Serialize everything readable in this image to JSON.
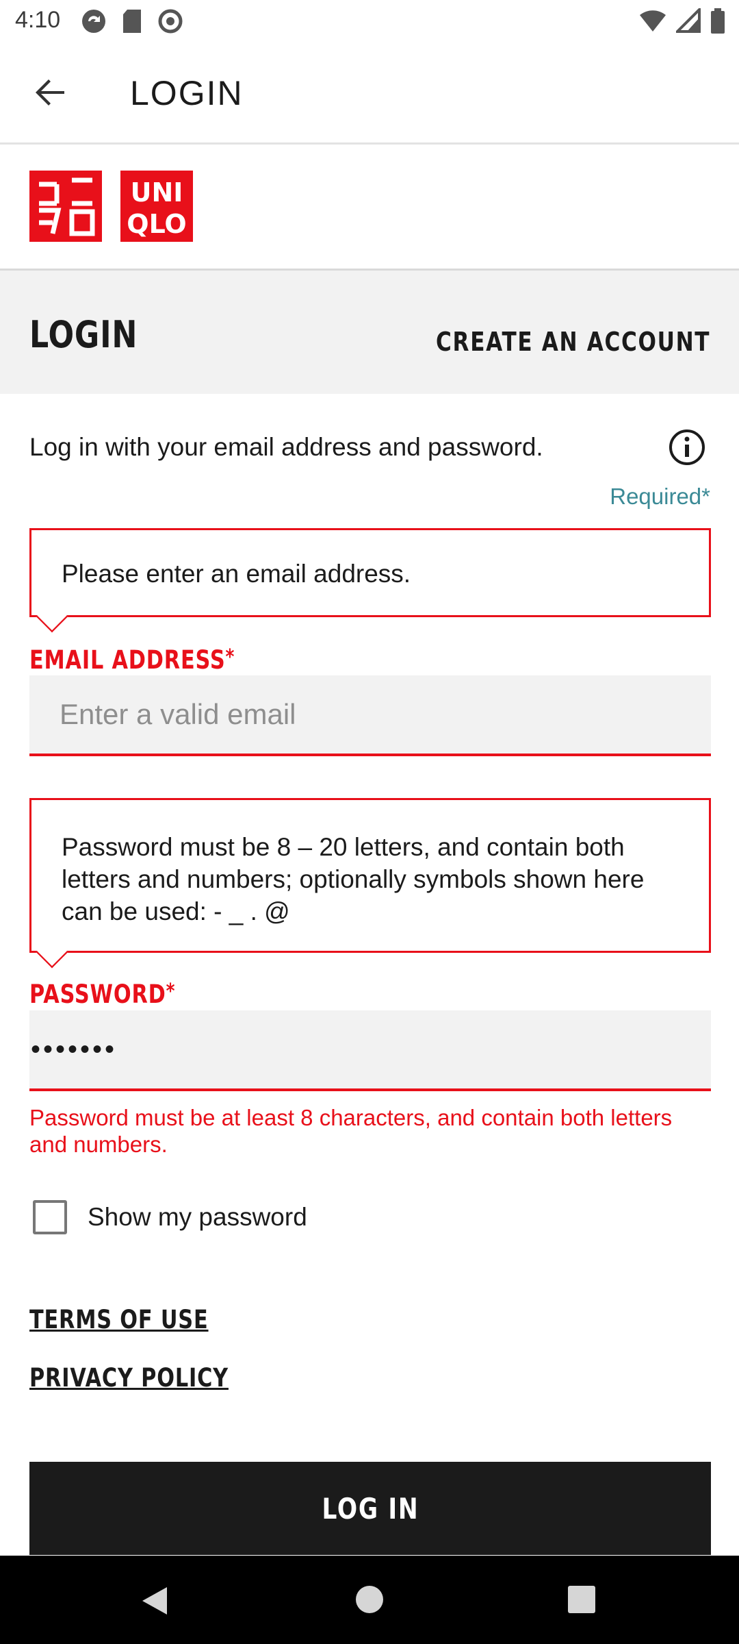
{
  "status_bar": {
    "time": "4:10"
  },
  "app_bar": {
    "title": "LOGIN"
  },
  "logo": {
    "brand": "UNIQLO",
    "text_lines": [
      "UNI",
      "QLO"
    ],
    "color": "#e8101a"
  },
  "tabs": {
    "login": "LOGIN",
    "create_account": "CREATE AN ACCOUNT"
  },
  "form": {
    "intro": "Log in with your email address and password.",
    "required_label": "Required",
    "required_mark": "*",
    "email": {
      "tooltip": "Please enter an email address.",
      "label": "EMAIL ADDRESS",
      "placeholder": "Enter a valid email",
      "value": ""
    },
    "password": {
      "tooltip": "Password must be 8 – 20 letters, and contain both letters and numbers; optionally symbols shown here can be used: - _ . @",
      "label": "PASSWORD",
      "value": "•••••••",
      "error": "Password must be at least 8 characters, and contain both letters and numbers."
    },
    "show_password": {
      "label": "Show my password",
      "checked": false
    }
  },
  "links": {
    "terms": "TERMS OF USE",
    "privacy": "PRIVACY POLICY"
  },
  "buttons": {
    "login": "LOG IN"
  },
  "colors": {
    "accent_red": "#e8101a",
    "required_teal": "#3b8a96",
    "button_black": "#1b1b1b"
  }
}
